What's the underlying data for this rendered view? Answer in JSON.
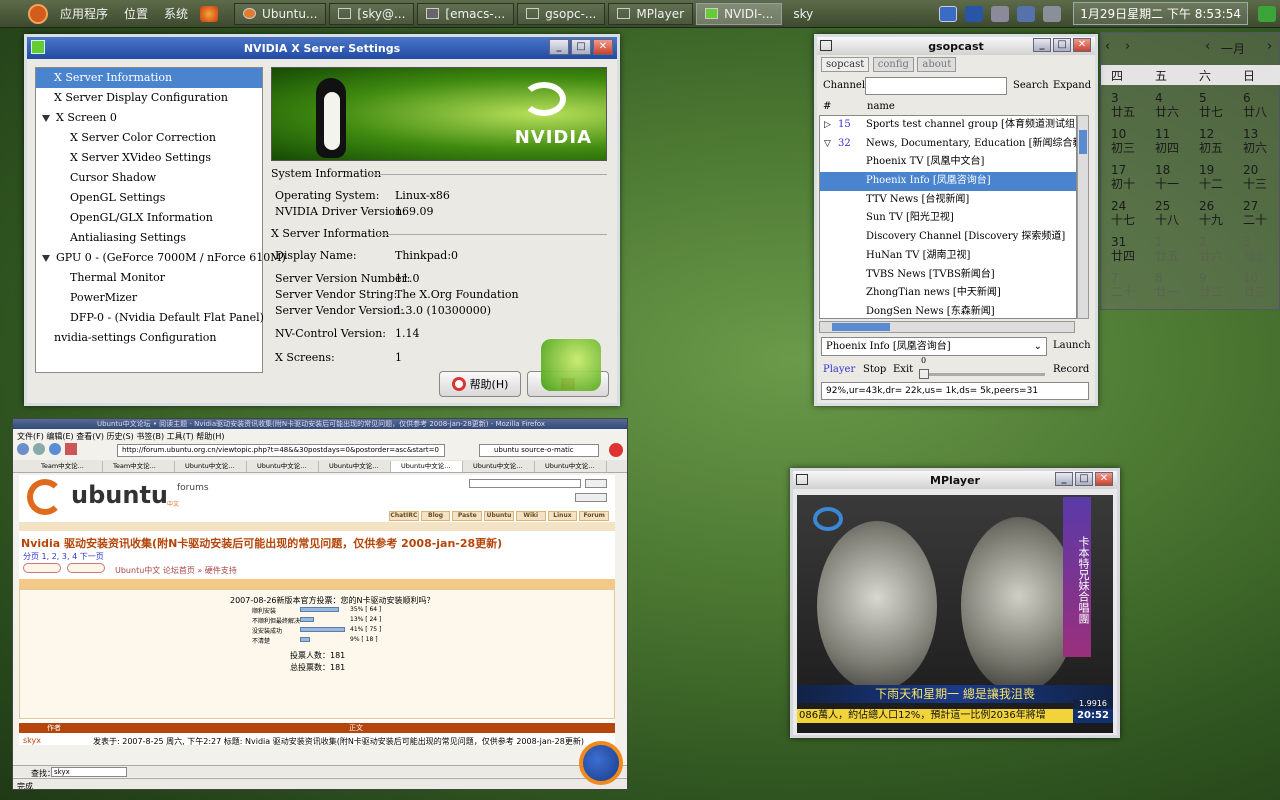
{
  "panel": {
    "menus": [
      "应用程序",
      "位置",
      "系统"
    ],
    "tasks": [
      {
        "label": "Ubuntu..."
      },
      {
        "label": "[sky@..."
      },
      {
        "label": "[emacs-..."
      },
      {
        "label": "gsopc-..."
      },
      {
        "label": "MPlayer"
      },
      {
        "label": "NVIDI-..."
      },
      {
        "label": "sky"
      }
    ],
    "clock": "1月29日星期二 下午 8:53:54"
  },
  "nvidia": {
    "title": "NVIDIA X Server Settings",
    "tree": [
      {
        "label": "X Server Information",
        "indent": 0,
        "selected": true
      },
      {
        "label": "X Server Display Configuration",
        "indent": 0
      },
      {
        "label": "X Screen 0",
        "indent": 0,
        "expander": true
      },
      {
        "label": "X Server Color Correction",
        "indent": 1
      },
      {
        "label": "X Server XVideo Settings",
        "indent": 1
      },
      {
        "label": "Cursor Shadow",
        "indent": 1
      },
      {
        "label": "OpenGL Settings",
        "indent": 1
      },
      {
        "label": "OpenGL/GLX Information",
        "indent": 1
      },
      {
        "label": "Antialiasing Settings",
        "indent": 1
      },
      {
        "label": "GPU 0 - (GeForce 7000M / nForce 610M)",
        "indent": 0,
        "expander": true
      },
      {
        "label": "Thermal Monitor",
        "indent": 1
      },
      {
        "label": "PowerMizer",
        "indent": 1
      },
      {
        "label": "DFP-0 - (Nvidia Default Flat Panel)",
        "indent": 1
      },
      {
        "label": "nvidia-settings Configuration",
        "indent": 0
      }
    ],
    "banner_logo": "NVIDIA",
    "system_info": "System Information",
    "os_label": "Operating System:",
    "os_value": "Linux-x86",
    "driver_label": "NVIDIA Driver Version:",
    "driver_value": "169.09",
    "xserver_info": "X Server Information",
    "display_label": "Display Name:",
    "display_value": "Thinkpad:0",
    "svn_label": "Server Version Number:",
    "svn_value": "11.0",
    "svs_label": "Server Vendor String:",
    "svs_value": "The X.Org Foundation",
    "svv_label": "Server Vendor Version:",
    "svv_value": "1.3.0 (10300000)",
    "nvctrl_label": "NV-Control Version:",
    "nvctrl_value": "1.14",
    "xscreens_label": "X Screens:",
    "xscreens_value": "1",
    "help_btn": "帮助(H)"
  },
  "gsopcast": {
    "title": "gsopcast",
    "tabs": [
      "sopcast",
      "config",
      "about"
    ],
    "channel_label": "Channel",
    "search_btn": "Search",
    "expand_btn": "Expand",
    "col_num": "#",
    "col_name": "name",
    "rows": [
      {
        "num": "15",
        "name": "Sports test channel group [体育频道测试组]",
        "expander": "right"
      },
      {
        "num": "32",
        "name": "News, Documentary, Education [新闻综合教育类]",
        "expander": "down"
      },
      {
        "name": "Phoenix TV [凤凰中文台]"
      },
      {
        "name": "Phoenix Info [凤凰咨询台]",
        "selected": true
      },
      {
        "name": "TTV News [台视新闻]"
      },
      {
        "name": "Sun TV [阳光卫视]"
      },
      {
        "name": "Discovery Channel [Discovery 探索频道]"
      },
      {
        "name": "HuNan TV [湖南卫视]"
      },
      {
        "name": "TVBS News [TVBS新闻台]"
      },
      {
        "name": "ZhongTian news [中天新闻]"
      },
      {
        "name": "DongSen News [东森新闻]"
      }
    ],
    "combo_value": "Phoenix Info [凤凰咨询台]",
    "launch_btn": "Launch",
    "player_btn": "Player",
    "stop_btn": "Stop",
    "exit_btn": "Exit",
    "slider_value": "0",
    "record_btn": "Record",
    "status": "92%,ur=43k,dr= 22k,us= 1k,ds= 5k,peers=31"
  },
  "calendar": {
    "month": "一月",
    "weekdays": [
      "四",
      "五",
      "六",
      "日"
    ],
    "rows": [
      [
        [
          "3",
          "廿五"
        ],
        [
          "4",
          "廿六"
        ],
        [
          "5",
          "廿七"
        ],
        [
          "6",
          "廿八"
        ]
      ],
      [
        [
          "10",
          "初三"
        ],
        [
          "11",
          "初四"
        ],
        [
          "12",
          "初五"
        ],
        [
          "13",
          "初六"
        ]
      ],
      [
        [
          "17",
          "初十"
        ],
        [
          "18",
          "十一"
        ],
        [
          "19",
          "十二"
        ],
        [
          "20",
          "十三"
        ]
      ],
      [
        [
          "24",
          "十七"
        ],
        [
          "25",
          "十八"
        ],
        [
          "26",
          "十九"
        ],
        [
          "27",
          "二十"
        ]
      ],
      [
        [
          "31",
          "廿四"
        ],
        [
          "1",
          "廿五"
        ],
        [
          "2",
          "廿六"
        ],
        [
          "3",
          "廿七"
        ]
      ],
      [
        [
          "7",
          "二十"
        ],
        [
          "8",
          "廿一"
        ],
        [
          "9",
          "廿二"
        ],
        [
          "10",
          "廿三"
        ]
      ]
    ]
  },
  "browser": {
    "title": "Ubuntu中文论坛 • 阅读主题 - Nvidia驱动安装资讯收集(附N卡驱动安装后可能出现的常见问题，仅供参考 2008-jan-28更新) - Mozilla Firefox",
    "menu": "文件(F)  编辑(E)  查看(V)  历史(S)  书签(B)  工具(T)  帮助(H)",
    "url": "http://forum.ubuntu.org.cn/viewtopic.php?t=48&&30postdays=0&postorder=asc&start=0",
    "search_engine": "ubuntu source-o-matic",
    "tabs": [
      "Team中文论...",
      "Team中文论...",
      "Ubuntu中文论...",
      "Ubuntu中文论...",
      "Ubuntu中文论...",
      "Ubuntu中文论...",
      "Ubuntu中文论...",
      "Ubuntu中文论..."
    ],
    "logo": "ubuntu",
    "logo_sub": "forums",
    "logo_cn": "中文",
    "nav": [
      "ChatIRC",
      "Blog",
      "Paste",
      "Ubuntu",
      "Wiki",
      "Linux",
      "Forum"
    ],
    "topic": "Nvidia 驱动安装资讯收集(附N卡驱动安装后可能出现的常见问题，仅供参考 2008-jan-28更新)",
    "pages": "分页 1, 2, 3, 4  下一页",
    "crumbs": "Ubuntu中文 论坛首页 » 硬件支持",
    "poll_title": "2007-08-26新版本官方投票：您的N卡驱动安装顺利吗？",
    "poll": [
      {
        "label": "顺利安装",
        "pct": 35,
        "text": "35% [ 64 ]"
      },
      {
        "label": "不顺利但最终解决",
        "pct": 13,
        "text": "13% [ 24 ]"
      },
      {
        "label": "没安装成功",
        "pct": 41,
        "text": "41% [ 75 ]"
      },
      {
        "label": "不清楚",
        "pct": 9,
        "text": "9% [ 18 ]"
      }
    ],
    "poll_total": "投票人数：181",
    "poll_total2": "总投票数：181",
    "col_author": "作者",
    "col_body": "正文",
    "author": "skyx",
    "post_meta": "发表于: 2007-8-25 周六, 下午2:27    标题: Nvidia 驱动安装资讯收集(附N卡驱动安装后可能出现的常见问题，仅供参考 2008-jan-28更新)",
    "find_label": "查找：",
    "find_value": "skyx",
    "status": "完成"
  },
  "mplayer": {
    "title": "MPlayer",
    "ticker": "086萬人，約佔總人口12%，預計這一比例2036年將增",
    "headline": "下雨天和星期一 總是讓我沮喪",
    "time": "20:52",
    "stock": "1.9916",
    "vertical_caption": "卡本特兄妹合唱團"
  }
}
